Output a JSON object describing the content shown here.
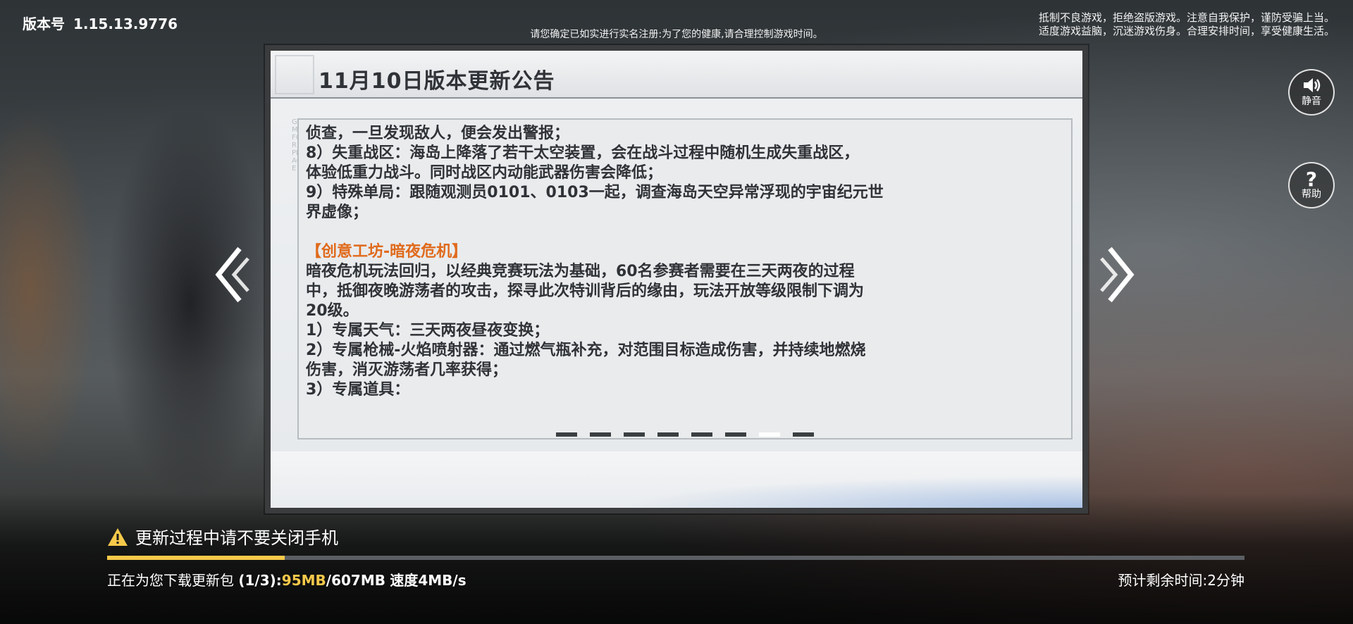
{
  "version": {
    "label": "版本号",
    "number": "1.15.13.9776"
  },
  "top_notice": "请您确定已如实进行实名注册:为了您的健康,请合理控制游戏时间。",
  "health_notice": {
    "line1": "抵制不良游戏，拒绝盗版游戏。注意自我保护，谨防受骗上当。",
    "line2": "适度游戏益脑，沉迷游戏伤身。合理安排时间，享受健康生活。"
  },
  "side_buttons": {
    "mute_label": "静音",
    "help_label": "帮助"
  },
  "dialog": {
    "title": "11月10日版本更新公告",
    "vertical_watermark": "GAME FOR PEACE",
    "content": {
      "lines": [
        "侦查，一旦发现敌人，便会发出警报；",
        "8）失重战区：海岛上降落了若干太空装置，会在战斗过程中随机生成失重战区，",
        "体验低重力战斗。同时战区内动能武器伤害会降低；",
        "9）特殊单局：跟随观测员0101、0103一起，调查海岛天空异常浮现的宇宙纪元世",
        "界虚像；"
      ],
      "section_title": "【创意工坊-暗夜危机】",
      "section_lines": [
        "暗夜危机玩法回归，以经典竞赛玩法为基础，60名参赛者需要在三天两夜的过程",
        "中，抵御夜晚游荡者的攻击，探寻此次特训背后的缘由，玩法开放等级限制下调为",
        "20级。",
        "1）专属天气：三天两夜昼夜变换；",
        "2）专属枪械-火焰喷射器：通过燃气瓶补充，对范围目标造成伤害，并持续地燃烧",
        "伤害，消灭游荡者几率获得；",
        "3）专属道具："
      ]
    },
    "page_count": 8,
    "active_page": 7
  },
  "warning": "更新过程中请不要关闭手机",
  "download": {
    "prefix": "正在为您下载更新包",
    "step": "(1/3):",
    "downloaded": "95MB",
    "total": "/607MB",
    "speed": "速度4MB/s",
    "progress_fraction": 0.156
  },
  "eta": "预计剩余时间:2分钟",
  "colors": {
    "accent": "#f6c94a",
    "section_title": "#e06a1c",
    "dialog_frame": "#3a3c3e"
  }
}
